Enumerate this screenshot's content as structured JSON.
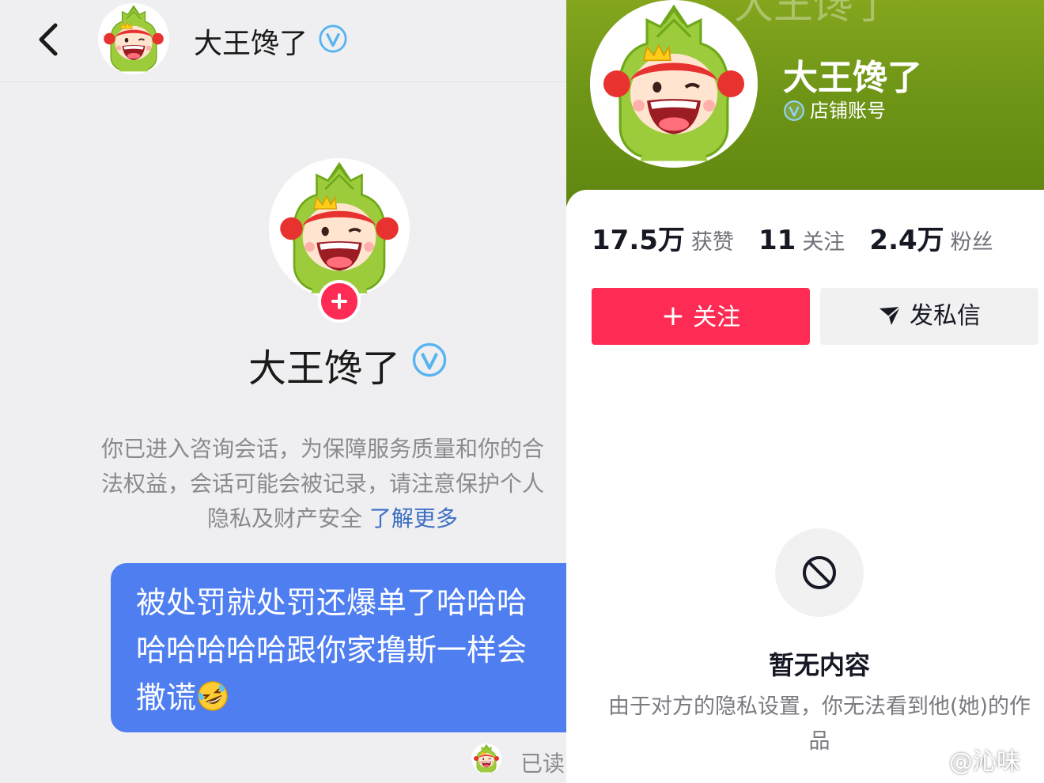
{
  "chat": {
    "header": {
      "name": "大王馋了",
      "back_icon": "chevron-left-icon",
      "verified_icon": "verified-v-icon"
    },
    "profile": {
      "name": "大王馋了",
      "follow_badge_icon": "plus-icon"
    },
    "notice": {
      "line1": "你已进入咨询会话，为保障服务质量和你的合",
      "line2": "法权益，会话可能会被记录，请注意保护个人",
      "line3": "隐私及财产安全",
      "link": "了解更多"
    },
    "message": {
      "line1": "被处罚就处罚还爆单了哈哈哈",
      "line2": "哈哈哈哈哈跟你家撸斯一样会",
      "line3": "撒谎",
      "emoji": "rolling-on-floor-laughing-emoji"
    },
    "read_status": "已读"
  },
  "profile_page": {
    "banner_text": "大王馋了",
    "name": "大王馋了",
    "account_type": "店铺账号",
    "stats": [
      {
        "value": "17.5万",
        "label": "获赞"
      },
      {
        "value": "11",
        "label": "关注"
      },
      {
        "value": "2.4万",
        "label": "粉丝"
      }
    ],
    "follow_button": "关注",
    "message_button": "发私信",
    "empty": {
      "title": "暂无内容",
      "description": "由于对方的隐私设置，你无法看到他(她)的作品"
    }
  },
  "watermark": "@沁味",
  "colors": {
    "accent_red": "#fe2c55",
    "bubble_blue": "#4e7ef0",
    "verified_blue": "#58b4f0",
    "banner_green": "#6f9517",
    "link_blue": "#3d6fc4"
  }
}
